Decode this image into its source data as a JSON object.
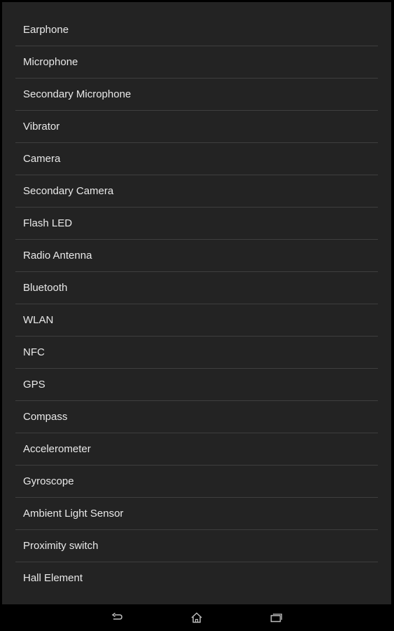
{
  "list": {
    "items": [
      {
        "label": "Earphone"
      },
      {
        "label": "Microphone"
      },
      {
        "label": "Secondary Microphone"
      },
      {
        "label": "Vibrator"
      },
      {
        "label": "Camera"
      },
      {
        "label": "Secondary Camera"
      },
      {
        "label": "Flash LED"
      },
      {
        "label": "Radio Antenna"
      },
      {
        "label": "Bluetooth"
      },
      {
        "label": "WLAN"
      },
      {
        "label": "NFC"
      },
      {
        "label": "GPS"
      },
      {
        "label": "Compass"
      },
      {
        "label": "Accelerometer"
      },
      {
        "label": "Gyroscope"
      },
      {
        "label": "Ambient Light Sensor"
      },
      {
        "label": "Proximity switch"
      },
      {
        "label": "Hall Element"
      }
    ]
  },
  "navbar": {
    "back_icon": "back-icon",
    "home_icon": "home-icon",
    "recents_icon": "recent-apps-icon"
  },
  "colors": {
    "background": "#232323",
    "divider": "#3e3e3e",
    "text": "#e9e9e9",
    "navbar": "#000000"
  }
}
